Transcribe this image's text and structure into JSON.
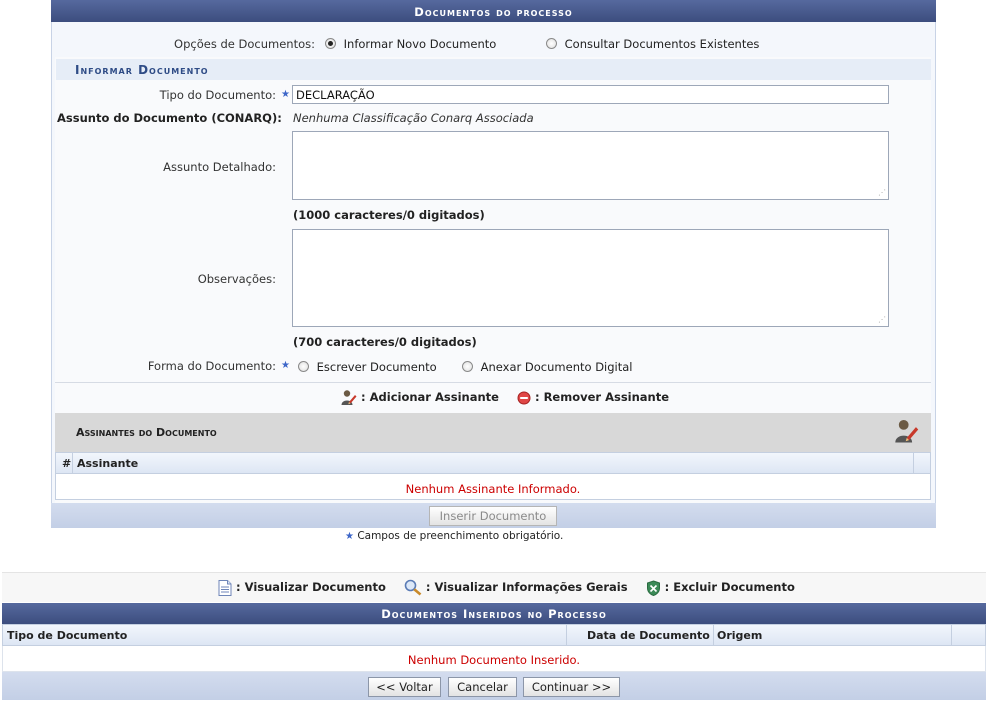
{
  "main_panel": {
    "title": "Documentos do processo",
    "options_label": "Opções de Documentos:",
    "option_new": "Informar Novo Documento",
    "option_existing": "Consultar Documentos Existentes",
    "section_title": "Informar Documento",
    "tipo_label": "Tipo do Documento:",
    "tipo_value": "DECLARAÇÃO",
    "assunto_label": "Assunto do Documento (CONARQ):",
    "assunto_value": "Nenhuma Classificação Conarq Associada",
    "assunto_detalhado_label": "Assunto Detalhado:",
    "assunto_counter": "(1000 caracteres/0 digitados)",
    "observacoes_label": "Observações:",
    "observacoes_counter": "(700 caracteres/0 digitados)",
    "forma_label": "Forma do Documento:",
    "forma_option_escrever": "Escrever Documento",
    "forma_option_anexar": "Anexar Documento Digital",
    "legend_add": ": Adicionar Assinante",
    "legend_remove": ": Remover Assinante",
    "signers_title": "Assinantes do Documento",
    "signers_col_num": "#",
    "signers_col_name": "Assinante",
    "signers_empty": "Nenhum Assinante Informado.",
    "insert_button": "Inserir Documento",
    "required_note": "Campos de preenchimento obrigatório."
  },
  "documents_panel": {
    "legend_view": ": Visualizar Documento",
    "legend_info": ": Visualizar Informações Gerais",
    "legend_delete": ": Excluir Documento",
    "title": "Documentos Inseridos no Processo",
    "col_tipo": "Tipo de Documento",
    "col_data": "Data de Documento",
    "col_origem": "Origem",
    "empty": "Nenhum Documento Inserido.",
    "back_button": "<< Voltar",
    "cancel_button": "Cancelar",
    "continue_button": "Continuar >>"
  },
  "colors": {
    "caption_bg": "#3c4d7e",
    "section_text": "#2f4c86",
    "error_text": "#cc0000",
    "required_star": "#3d66c8"
  },
  "icons": [
    "add-signer-icon",
    "remove-signer-icon",
    "add-signer-icon",
    "view-document-icon",
    "magnifier-icon",
    "delete-document-icon",
    "required-star-icon"
  ]
}
